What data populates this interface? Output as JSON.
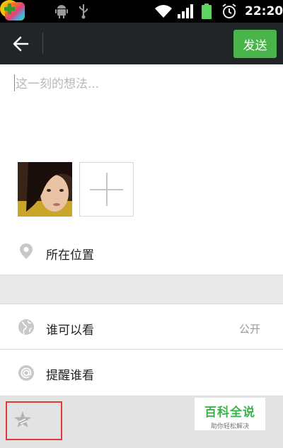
{
  "status_bar": {
    "time": "22:20",
    "icons": [
      "app-icon-colorful",
      "app-icon-plus",
      "android-debug-icon",
      "usb-icon",
      "wifi-icon",
      "signal-icon",
      "battery-icon",
      "alarm-icon"
    ]
  },
  "title_bar": {
    "back_icon": "arrow-left-icon",
    "send_label": "发送",
    "send_color": "#48b44a"
  },
  "compose": {
    "placeholder": "这一刻的想法..."
  },
  "rows": {
    "location": {
      "label": "所在位置",
      "icon": "location-pin-icon"
    },
    "visibility": {
      "label": "谁可以看",
      "value": "公开",
      "icon": "globe-icon"
    },
    "mention": {
      "label": "提醒谁看",
      "icon": "at-sign-icon"
    }
  },
  "bottom": {
    "icon": "star-icon"
  },
  "watermark": {
    "title": "百科全说",
    "subtitle": "助你轻松解决"
  }
}
